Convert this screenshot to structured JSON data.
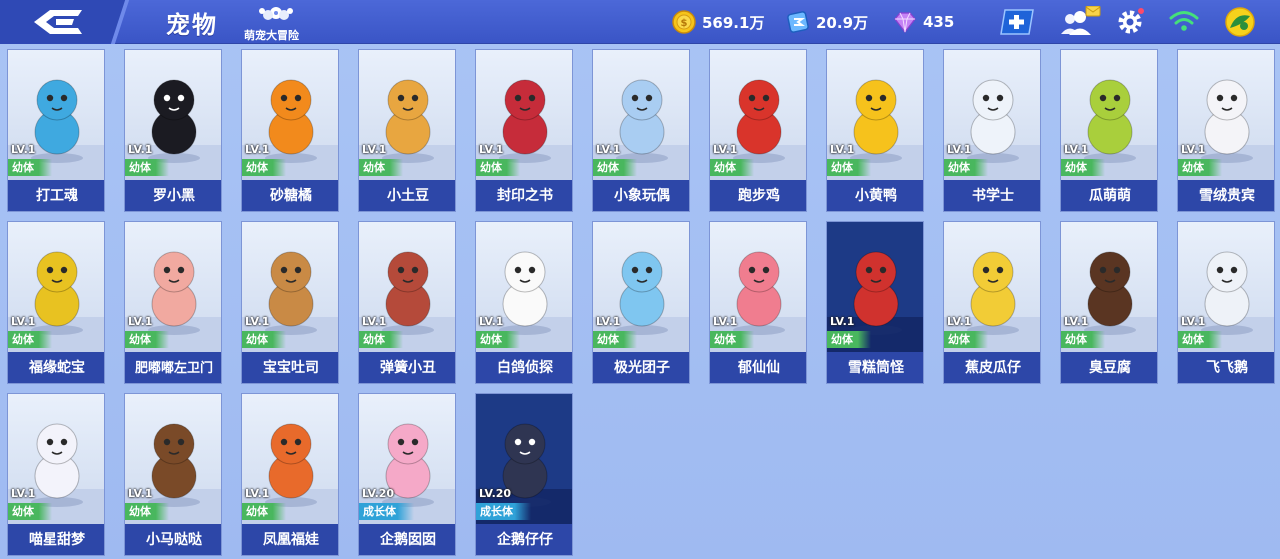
{
  "header": {
    "title": "宠物",
    "logo_text": "萌宠大冒险",
    "gold": "569.1万",
    "coupon": "20.9万",
    "diamond": "435"
  },
  "icons": {
    "back": "back-arrow-icon",
    "gold": "gold-coin-icon",
    "coupon": "coupon-icon",
    "diamond": "diamond-icon",
    "add": "plus-icon",
    "friends": "friends-icon",
    "settings": "gear-icon",
    "wifi": "wifi-icon",
    "avatar": "avatar-icon"
  },
  "colors": {
    "topbar": "#3a55c6",
    "name_bar": "#2d47a8",
    "stage_child": "#49b75e",
    "stage_grow": "#2fa2d8"
  },
  "pets": [
    {
      "name": "打工魂",
      "level": "LV.1",
      "stage": "幼体",
      "color": "#3fa9e0"
    },
    {
      "name": "罗小黑",
      "level": "LV.1",
      "stage": "幼体",
      "color": "#1b1b22"
    },
    {
      "name": "砂糖橘",
      "level": "LV.1",
      "stage": "幼体",
      "color": "#f28a1c"
    },
    {
      "name": "小土豆",
      "level": "LV.1",
      "stage": "幼体",
      "color": "#e8a640"
    },
    {
      "name": "封印之书",
      "level": "LV.1",
      "stage": "幼体",
      "color": "#c62c3a"
    },
    {
      "name": "小象玩偶",
      "level": "LV.1",
      "stage": "幼体",
      "color": "#a9cdf2"
    },
    {
      "name": "跑步鸡",
      "level": "LV.1",
      "stage": "幼体",
      "color": "#d9342b"
    },
    {
      "name": "小黄鸭",
      "level": "LV.1",
      "stage": "幼体",
      "color": "#f6c21c"
    },
    {
      "name": "书学士",
      "level": "LV.1",
      "stage": "幼体",
      "color": "#eef3fa"
    },
    {
      "name": "瓜萌萌",
      "level": "LV.1",
      "stage": "幼体",
      "color": "#a9cf3c"
    },
    {
      "name": "雪绒贵宾",
      "level": "LV.1",
      "stage": "幼体",
      "color": "#f4f4f8"
    },
    {
      "name": "福缘蛇宝",
      "level": "LV.1",
      "stage": "幼体",
      "color": "#e8c221"
    },
    {
      "name": "肥嘟嘟左卫门",
      "level": "LV.1",
      "stage": "幼体",
      "color": "#f1a9a0"
    },
    {
      "name": "宝宝吐司",
      "level": "LV.1",
      "stage": "幼体",
      "color": "#c98a45"
    },
    {
      "name": "弹簧小丑",
      "level": "LV.1",
      "stage": "幼体",
      "color": "#b54a3a"
    },
    {
      "name": "白鸽侦探",
      "level": "LV.1",
      "stage": "幼体",
      "color": "#fafafa"
    },
    {
      "name": "极光团子",
      "level": "LV.1",
      "stage": "幼体",
      "color": "#7fc6f0"
    },
    {
      "name": "郁仙仙",
      "level": "LV.1",
      "stage": "幼体",
      "color": "#f07d8f"
    },
    {
      "name": "雪糕筒怪",
      "level": "LV.1",
      "stage": "幼体",
      "color": "#d0322e"
    },
    {
      "name": "蕉皮瓜仔",
      "level": "LV.1",
      "stage": "幼体",
      "color": "#f2cc36"
    },
    {
      "name": "臭豆腐",
      "level": "LV.1",
      "stage": "幼体",
      "color": "#5a3522"
    },
    {
      "name": "飞飞鹅",
      "level": "LV.1",
      "stage": "幼体",
      "color": "#eef2f8"
    },
    {
      "name": "喵星甜梦",
      "level": "LV.1",
      "stage": "幼体",
      "color": "#f3f3fb"
    },
    {
      "name": "小马哒哒",
      "level": "LV.1",
      "stage": "幼体",
      "color": "#7a4a28"
    },
    {
      "name": "凤凰福娃",
      "level": "LV.1",
      "stage": "幼体",
      "color": "#e86a2b"
    },
    {
      "name": "企鹅囡囡",
      "level": "LV.20",
      "stage": "成长体",
      "color": "#f5a9c8"
    },
    {
      "name": "企鹅仔仔",
      "level": "LV.20",
      "stage": "成长体",
      "color": "#2f3552"
    }
  ]
}
